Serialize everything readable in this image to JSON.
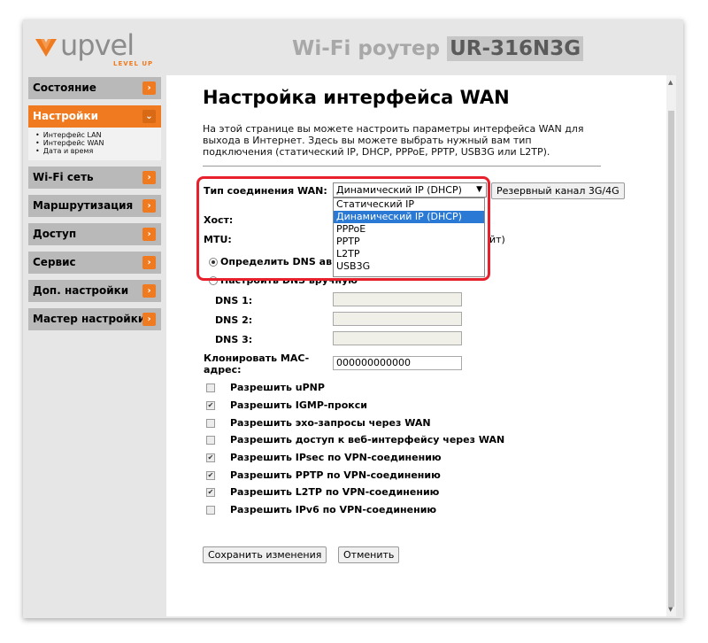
{
  "header": {
    "logo_text": "upvel",
    "logo_tagline": "LEVEL UP",
    "product_prefix": "Wi-Fi роутер",
    "model": "UR-316N3G"
  },
  "sidebar": {
    "items": [
      {
        "label": "Состояние",
        "arrow": "›"
      },
      {
        "label": "Настройки",
        "arrow": "⌄"
      },
      {
        "label": "Wi-Fi сеть",
        "arrow": "›"
      },
      {
        "label": "Маршрутизация",
        "arrow": "›"
      },
      {
        "label": "Доступ",
        "arrow": "›"
      },
      {
        "label": "Сервис",
        "arrow": "›"
      },
      {
        "label": "Доп. настройки",
        "arrow": "›"
      },
      {
        "label": "Мастер настройки",
        "arrow": "›"
      }
    ],
    "sub_items": [
      "Интерфейс LAN",
      "Интерфейс WAN",
      "Дата и время"
    ]
  },
  "main": {
    "title": "Настройка интерфейса WAN",
    "description": "На этой странице вы можете настроить параметры интерфейса WAN для выхода в Интернет. Здесь вы можете выбрать нужный вам тип подключения (статический IP, DHCP, PPPoE, PPTP, USB3G или L2TP).",
    "wan_type_label": "Тип соединения WAN:",
    "wan_type_value": "Динамический IP (DHCP)",
    "backup_button": "Резервный канал 3G/4G",
    "wan_options": [
      "Статический IP",
      "Динамический IP (DHCP)",
      "PPPoE",
      "PPTP",
      "L2TP",
      "USB3G"
    ],
    "host_label": "Хост:",
    "mtu_label": "MTU:",
    "mtu_suffix": "йт)",
    "dns_auto_label": "Определить DNS ав",
    "dns_manual_label": "Настроить DNS вручную",
    "dns1_label": "DNS 1:",
    "dns2_label": "DNS 2:",
    "dns3_label": "DNS 3:",
    "mac_label": "Клонировать MAC-адрес:",
    "mac_value": "000000000000",
    "checkboxes": [
      {
        "label": "Разрешить uPNP",
        "checked": false
      },
      {
        "label": "Разрешить IGMP-прокси",
        "checked": true
      },
      {
        "label": "Разрешить эхо-запросы через WAN",
        "checked": false
      },
      {
        "label": "Разрешить доступ к веб-интерфейсу через WAN",
        "checked": false
      },
      {
        "label": "Разрешить IPsec по VPN-соединению",
        "checked": true
      },
      {
        "label": "Разрешить PPTP по VPN-соединению",
        "checked": true
      },
      {
        "label": "Разрешить L2TP по VPN-соединению",
        "checked": true
      },
      {
        "label": "Разрешить IPv6 по VPN-соединению",
        "checked": false
      }
    ],
    "save_button": "Сохранить изменения",
    "cancel_button": "Отменить"
  },
  "colors": {
    "accent": "#f07a1f",
    "highlight": "#e8202c",
    "selected": "#2a7ad5"
  }
}
